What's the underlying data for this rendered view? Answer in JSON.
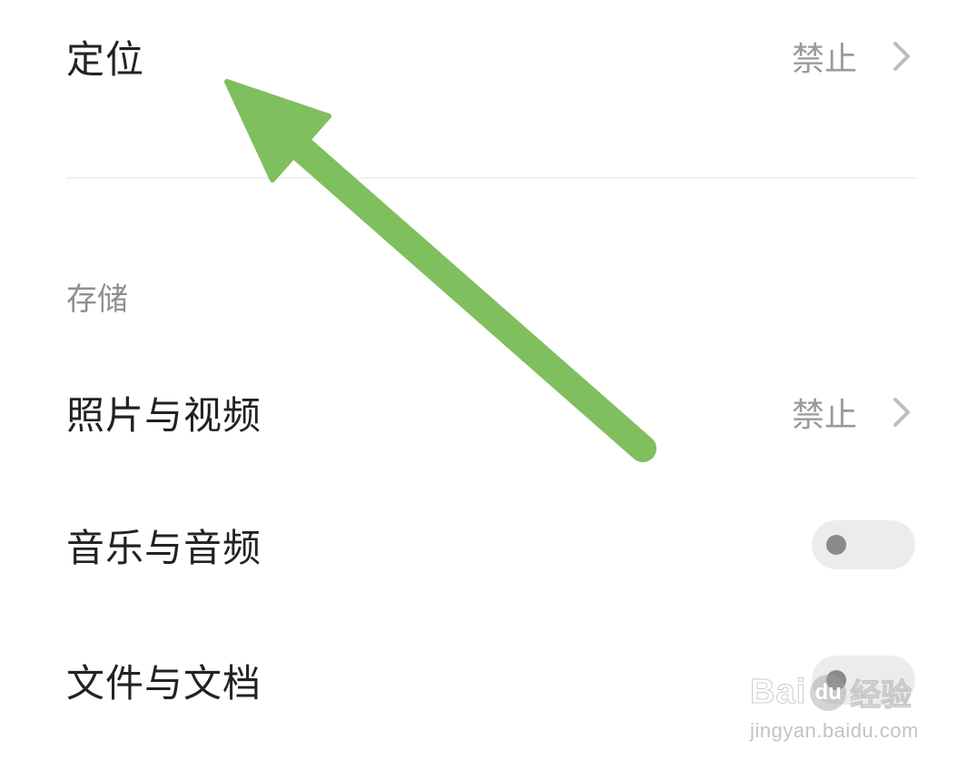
{
  "location": {
    "title": "定位",
    "value": "禁止"
  },
  "storage": {
    "header": "存储",
    "photos": {
      "title": "照片与视频",
      "value": "禁止"
    },
    "music": {
      "title": "音乐与音频",
      "toggle_on": false
    },
    "files": {
      "title": "文件与文档",
      "toggle_on": false
    }
  },
  "annotation": {
    "arrow_color": "#7fbf5e"
  },
  "watermark": {
    "brand": "Bai",
    "paw": "du",
    "suffix": "经验",
    "url": "jingyan.baidu.com"
  },
  "colors": {
    "title": "#222222",
    "value": "#9a9a9a",
    "toggle_track": "#ececec",
    "toggle_knob": "#8a8a8a"
  }
}
